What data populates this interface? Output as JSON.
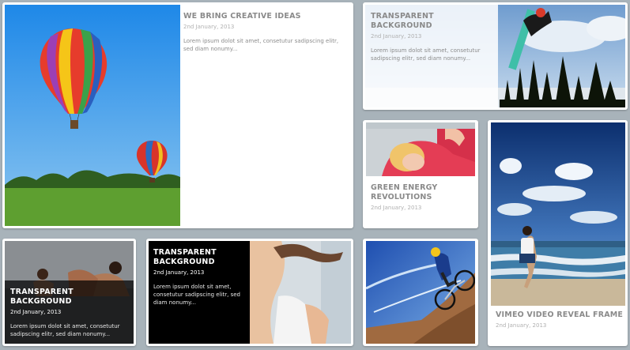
{
  "posts": [
    {
      "title": "WE BRING CREATIVE IDEAS",
      "date": "2nd January, 2013",
      "excerpt": "Lorem ipsum dolot sit amet, consetutur sadipscing elitr, sed diam nonumy..."
    },
    {
      "title": "TRANSPARENT BACKGROUND",
      "date": "2nd January, 2013",
      "excerpt": "Lorem ipsum dolot sit amet, consetutur sadipscing elitr, sed diam nonumy..."
    },
    {
      "title": "GREEN ENERGY REVOLUTIONS",
      "date": "2nd January, 2013",
      "excerpt": ""
    },
    {
      "title": "VIMEO VIDEO REVEAL FRAME",
      "date": "2nd January, 2013",
      "excerpt": ""
    },
    {
      "title": "TRANSPARENT BACKGROUND",
      "date": "2nd January, 2013",
      "excerpt": "Lorem ipsum dolot sit amet, consetutur sadipscing elitr, sed diam nonumy..."
    },
    {
      "title": "TRANSPARENT BACKGROUND",
      "date": "2nd January, 2013",
      "excerpt": "Lorem ipsum dolot sit amet, consetutur sadipscing elitr, sed diam nonumy..."
    }
  ],
  "colors": {
    "page_background": "#a8b3ba",
    "card_background": "#ffffff",
    "title_text": "#8a8a8a",
    "dark_overlay": "#000000"
  }
}
